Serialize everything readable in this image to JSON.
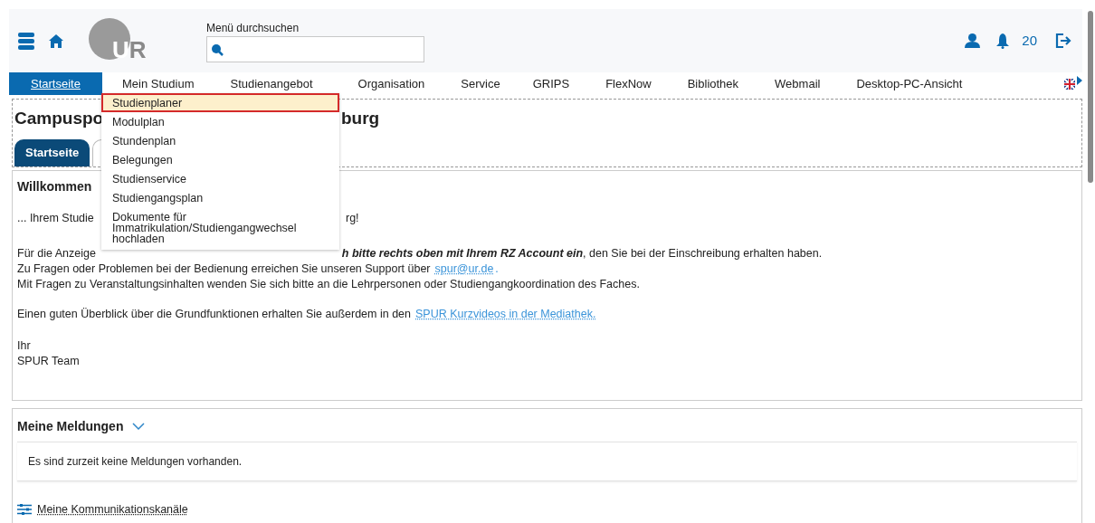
{
  "header": {
    "logo": "UR",
    "search": {
      "label": "Menü durchsuchen"
    },
    "notification_count": "20"
  },
  "nav": [
    {
      "label": "Startseite",
      "selected": true
    },
    {
      "label": "Mein Studium",
      "selected": false
    },
    {
      "label": "Studienangebot",
      "selected": false
    },
    {
      "label": "Organisation",
      "selected": false
    },
    {
      "label": "Service",
      "selected": false
    },
    {
      "label": "GRIPS",
      "selected": false
    },
    {
      "label": "FlexNow",
      "selected": false
    },
    {
      "label": "Bibliothek",
      "selected": false
    },
    {
      "label": "Webmail",
      "selected": false
    },
    {
      "label": "Desktop-PC-Ansicht",
      "selected": false
    }
  ],
  "dropdown": [
    {
      "label": "Studienplaner",
      "selected": true
    },
    {
      "label": "Modulplan",
      "selected": false
    },
    {
      "label": "Stundenplan",
      "selected": false
    },
    {
      "label": "Belegungen",
      "selected": false
    },
    {
      "label": "Studienservice",
      "selected": false
    },
    {
      "label": "Studiengangsplan",
      "selected": false
    },
    {
      "label": "Dokumente für Immatrikulation/Studiengangwechsel hochladen",
      "selected": false
    }
  ],
  "page": {
    "title_left": "Campuspo",
    "title_right": "burg",
    "tabs": [
      {
        "label": "Startseite",
        "selected": true
      }
    ]
  },
  "welcome": {
    "heading": "Willkommen",
    "greeting_left": "... Ihrem Studie",
    "greeting_right": "rg!",
    "login_left": "Für die Anzeige",
    "login_right": "**h bitte rechts oben mit Ihrem RZ Account ein**, den Sie bei der Einschreibung erhalten haben.",
    "support_text": "Zu Fragen oder Problemen bei der Bedienung erreichen Sie unseren Support über",
    "support_link": "spur@ur.de",
    "support_end": ".",
    "contact_text": "Mit Fragen zu Veranstaltungsinhalten wenden Sie sich bitte an die Lehrpersonen oder Studiengangkoordination des Faches.",
    "overview_text": "Einen guten Überblick über die Grundfunktionen erhalten Sie außerdem in den",
    "overview_link": "SPUR Kurzvideos in der Mediathek.",
    "sign_off": [
      "Ihr",
      "SPUR Team"
    ]
  },
  "messages": {
    "heading": "Meine Meldungen",
    "expanded": true,
    "empty_text": "Es sind zurzeit keine Meldungen vorhanden.",
    "channels_link": "Meine Kommunikationskanäle"
  }
}
